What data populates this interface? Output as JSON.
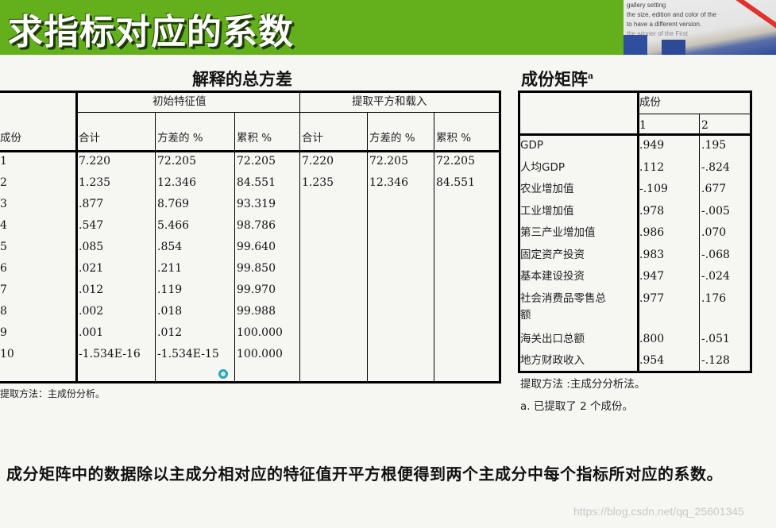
{
  "slide": {
    "title": "求指标对应的系数",
    "photo_text_lines": [
      "gallery setting",
      "the size, edition and color of the",
      "to have a different version.",
      "the winner of the First"
    ]
  },
  "variance_table": {
    "title": "解释的总方差",
    "row_header": "成份",
    "groups": [
      "初始特征值",
      "提取平方和载入"
    ],
    "columns": [
      "合计",
      "方差的 %",
      "累积 %",
      "合计",
      "方差的 %",
      "累积 %"
    ],
    "rows": [
      {
        "component": "1",
        "values": [
          "7.220",
          "72.205",
          "72.205",
          "7.220",
          "72.205",
          "72.205"
        ]
      },
      {
        "component": "2",
        "values": [
          "1.235",
          "12.346",
          "84.551",
          "1.235",
          "12.346",
          "84.551"
        ]
      },
      {
        "component": "3",
        "values": [
          ".877",
          "8.769",
          "93.319",
          "",
          "",
          ""
        ]
      },
      {
        "component": "4",
        "values": [
          ".547",
          "5.466",
          "98.786",
          "",
          "",
          ""
        ]
      },
      {
        "component": "5",
        "values": [
          ".085",
          ".854",
          "99.640",
          "",
          "",
          ""
        ]
      },
      {
        "component": "6",
        "values": [
          ".021",
          ".211",
          "99.850",
          "",
          "",
          ""
        ]
      },
      {
        "component": "7",
        "values": [
          ".012",
          ".119",
          "99.970",
          "",
          "",
          ""
        ]
      },
      {
        "component": "8",
        "values": [
          ".002",
          ".018",
          "99.988",
          "",
          "",
          ""
        ]
      },
      {
        "component": "9",
        "values": [
          ".001",
          ".012",
          "100.000",
          "",
          "",
          ""
        ]
      },
      {
        "component": "10",
        "values": [
          "-1.534E-16",
          "-1.534E-15",
          "100.000",
          "",
          "",
          ""
        ]
      }
    ],
    "footnote": "提取方法：主成份分析。"
  },
  "component_matrix": {
    "title": "成份矩阵",
    "title_sup": "a",
    "group": "成份",
    "columns": [
      "1",
      "2"
    ],
    "rows": [
      {
        "label": "GDP",
        "values": [
          ".949",
          ".195"
        ]
      },
      {
        "label": "人均GDP",
        "values": [
          ".112",
          "-.824"
        ]
      },
      {
        "label": "农业增加值",
        "values": [
          "-.109",
          ".677"
        ]
      },
      {
        "label": "工业增加值",
        "values": [
          ".978",
          "-.005"
        ]
      },
      {
        "label": "第三产业增加值",
        "values": [
          ".986",
          ".070"
        ]
      },
      {
        "label": "固定资产投资",
        "values": [
          ".983",
          "-.068"
        ]
      },
      {
        "label": "基本建设投资",
        "values": [
          ".947",
          "-.024"
        ]
      },
      {
        "label": "社会消费品零售总额",
        "label_line1": "社会消费品零售总",
        "label_line2": "额",
        "values": [
          ".977",
          ".176"
        ]
      },
      {
        "label": "海关出口总额",
        "values": [
          ".800",
          "-.051"
        ]
      },
      {
        "label": "地方财政收入",
        "values": [
          ".954",
          "-.128"
        ]
      }
    ],
    "footnote1": "提取方法 :主成分分析法。",
    "footnote2": "a. 已提取了 2 个成份。"
  },
  "summary": "成分矩阵中的数据除以主成分相对应的特征值开平方根便得到两个主成分中每个指标所对应的系数。",
  "watermark": "https://blog.csdn.net/qq_25601345"
}
